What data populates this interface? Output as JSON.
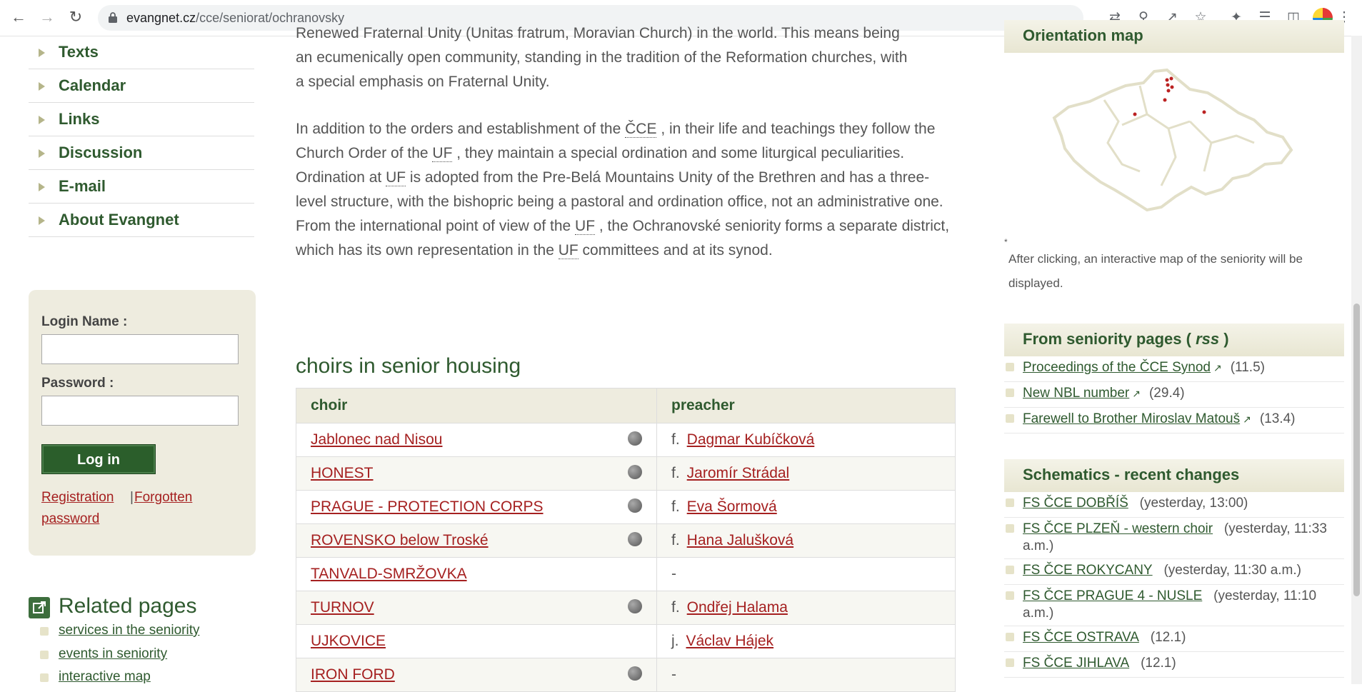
{
  "browser": {
    "url_host": "evangnet.cz",
    "url_path": "/cce/seniorat/ochranovsky"
  },
  "sidebar": {
    "items": [
      "Texts",
      "Calendar",
      "Links",
      "Discussion",
      "E-mail",
      "About Evangnet"
    ]
  },
  "login": {
    "name_label": "Login Name :",
    "password_label": "Password :",
    "button": "Log in",
    "registration": "Registration",
    "separator": "|",
    "forgotten_1": "Forgotten",
    "forgotten_2": "password"
  },
  "related": {
    "title": "Related pages",
    "items": [
      "services in the seniority",
      "events in seniority",
      "interactive map"
    ]
  },
  "main": {
    "para1_l1": "Renewed Fraternal Unity (Unitas fratrum, Moravian Church) in the world. This means being",
    "para1_l2": "an ecumenically open community, standing in the tradition of the Reformation churches, with",
    "para1_l3": "a special emphasis on Fraternal Unity.",
    "p2_a": "In addition to the orders and establishment of the ",
    "abbr_cce": "ČCE",
    "p2_b": " , in their life and teachings they follow the Church Order of the ",
    "abbr_uf": "UF",
    "p2_c": " , they maintain a special ordination and some liturgical peculiarities. Ordination at ",
    "p2_d": " is adopted from the Pre-Belá Mountains Unity of the Brethren and has a three-level structure, with the bishopric being a pastoral and ordination office, not an administrative one. From the international point of view of the ",
    "p2_e": " , the Ochranovské seniority forms a separate district, which has its own representation in the ",
    "p2_f": " committees and at its synod.",
    "choirs_heading": "choirs in senior housing",
    "table": {
      "col1": "choir",
      "col2": "preacher",
      "rows": [
        {
          "choir": "Jablonec nad Nisou",
          "globe": true,
          "prefix": "f.",
          "preacher": "Dagmar Kubíčková"
        },
        {
          "choir": "HONEST",
          "globe": true,
          "prefix": "f.",
          "preacher": "Jaromír Strádal"
        },
        {
          "choir": "PRAGUE - PROTECTION CORPS",
          "globe": true,
          "prefix": "f.",
          "preacher": "Eva Šormová"
        },
        {
          "choir": "ROVENSKO below Troské",
          "globe": true,
          "prefix": "f.",
          "preacher": "Hana Jalušková"
        },
        {
          "choir": "TANVALD-SMRŽOVKA",
          "globe": false,
          "prefix": "-",
          "preacher": ""
        },
        {
          "choir": "TURNOV",
          "globe": true,
          "prefix": "f.",
          "preacher": "Ondřej Halama"
        },
        {
          "choir": "UJKOVICE",
          "globe": false,
          "prefix": "j.",
          "preacher": "Václav Hájek"
        },
        {
          "choir": "IRON FORD",
          "globe": true,
          "prefix": "-",
          "preacher": ""
        }
      ]
    }
  },
  "right": {
    "map_title": "Orientation map",
    "map_note_star": "*",
    "map_note": "After clicking, an interactive map of the seniority will be displayed.",
    "seniority_title_a": "From seniority pages ( ",
    "seniority_title_rss": "rss",
    "seniority_title_b": " )",
    "seniority_items": [
      {
        "text": "Proceedings of the ČCE Synod",
        "date": "(11.5)"
      },
      {
        "text": "New NBL number",
        "date": "(29.4)"
      },
      {
        "text": "Farewell to Brother Miroslav Matouš",
        "date": "(13.4)"
      }
    ],
    "schematics_title": "Schematics - recent changes",
    "schematics_items": [
      {
        "text": "FS ČCE DOBŘÍŠ",
        "date": "(yesterday, 13:00)"
      },
      {
        "text": "FS ČCE PLZEŇ - western choir",
        "date": "(yesterday, 11:33 a.m.)"
      },
      {
        "text": "FS ČCE ROKYCANY",
        "date": "(yesterday, 11:30 a.m.)"
      },
      {
        "text": "FS ČCE PRAGUE 4 - NUSLE",
        "date": "(yesterday, 11:10 a.m.)"
      },
      {
        "text": "FS ČCE OSTRAVA",
        "date": "(12.1)"
      },
      {
        "text": "FS ČCE JIHLAVA",
        "date": "(12.1)"
      }
    ]
  },
  "colors": {
    "brand_green": "#2f5a2f",
    "link_red": "#a52020",
    "panel_beige": "#eeecdf"
  }
}
